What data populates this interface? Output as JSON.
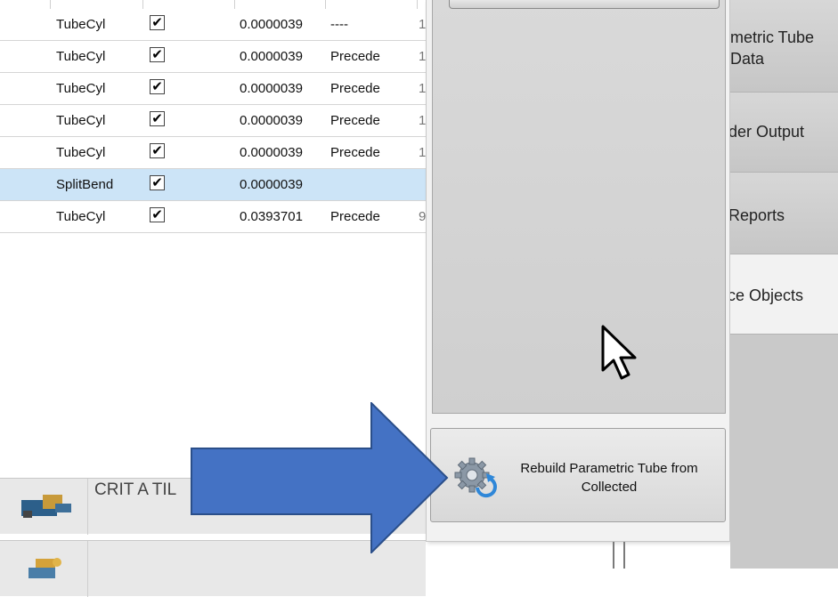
{
  "grid": {
    "rows": [
      {
        "type": "TubeCyl",
        "checked": "✔",
        "value": "0.0000039",
        "mode": "----",
        "extra": "1",
        "selected": false
      },
      {
        "type": "TubeCyl",
        "checked": "✔",
        "value": "0.0000039",
        "mode": "Precede",
        "extra": "1",
        "selected": false
      },
      {
        "type": "TubeCyl",
        "checked": "✔",
        "value": "0.0000039",
        "mode": "Precede",
        "extra": "1",
        "selected": false
      },
      {
        "type": "TubeCyl",
        "checked": "✔",
        "value": "0.0000039",
        "mode": "Precede",
        "extra": "1",
        "selected": false
      },
      {
        "type": "TubeCyl",
        "checked": "✔",
        "value": "0.0000039",
        "mode": "Precede",
        "extra": "1",
        "selected": false
      },
      {
        "type": "SplitBend",
        "checked": "✔",
        "value": "0.0000039",
        "mode": "",
        "extra": "",
        "selected": true
      },
      {
        "type": "TubeCyl",
        "checked": "✔",
        "value": "0.0393701",
        "mode": "Precede",
        "extra": "9",
        "selected": false
      }
    ]
  },
  "list": {
    "items": [
      {
        "label": "CRIT A TIL"
      },
      {
        "label": ""
      }
    ]
  },
  "popup": {
    "rebuild_label": "Rebuild Parametric Tube from\nCollected",
    "rebuild_icon": "gear-refresh-icon"
  },
  "sidebar": {
    "items": [
      {
        "label": "metric Tube\nData"
      },
      {
        "label": "der Output"
      },
      {
        "label": "Reports"
      },
      {
        "label": "ce Objects"
      }
    ]
  },
  "colors": {
    "arrow": "#4472c4",
    "selected_row": "#cce4f7"
  }
}
